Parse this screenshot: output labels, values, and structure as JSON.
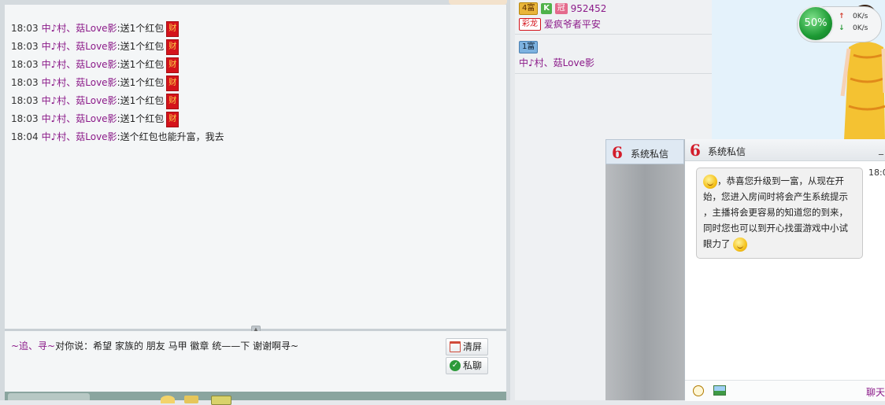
{
  "chat": {
    "messages": [
      {
        "time": "18:03",
        "user": "中♪村、菇Love影",
        "text": ":送1个红包",
        "gift_icon": "财"
      },
      {
        "time": "18:03",
        "user": "中♪村、菇Love影",
        "text": ":送1个红包",
        "gift_icon": "财"
      },
      {
        "time": "18:03",
        "user": "中♪村、菇Love影",
        "text": ":送1个红包",
        "gift_icon": "财"
      },
      {
        "time": "18:03",
        "user": "中♪村、菇Love影",
        "text": ":送1个红包",
        "gift_icon": "财"
      },
      {
        "time": "18:03",
        "user": "中♪村、菇Love影",
        "text": ":送1个红包",
        "gift_icon": "财"
      },
      {
        "time": "18:03",
        "user": "中♪村、菇Love影",
        "text": ":送1个红包",
        "gift_icon": "财"
      },
      {
        "time": "18:04",
        "user": "中♪村、菇Love影",
        "text": ":送个红包也能升富，我去"
      }
    ],
    "private_message": {
      "sender": "~追、寻~",
      "text": "对你说：希望 家族的 朋友 马甲 徽章 统——下 谢谢啊寻~"
    },
    "clear_label": "清屏",
    "private_chat_label": "私聊"
  },
  "user_list": [
    {
      "rank_badge": "4富",
      "k_badge": "K",
      "v_badge": "冠",
      "user_id": "952452",
      "title_badge": "彩龙",
      "name": "爱疯爷者平安"
    },
    {
      "rank_badge": "1富",
      "name": "中♪村、菇Love影"
    }
  ],
  "net_meter": {
    "percent": "50%",
    "upload": "0K/s",
    "download": "0K/s"
  },
  "system_messages": {
    "tab_title": "系统私信",
    "window_title": "系统私信",
    "minimize": "_",
    "time": "18:0",
    "body_line1": "，恭喜您升级到一富，从现在开",
    "body_line2": "始，您进入房间时将会产生系统提示",
    "body_line3": "，主播将会更容易的知道您的到来，",
    "body_line4": "同时您也可以到开心找蛋游戏中小试",
    "body_line5": "眼力了",
    "chat_link": "聊天"
  },
  "colors": {
    "username": "#8b1a89",
    "gift_red": "#d4131b",
    "meter_green": "#1d9a34"
  }
}
